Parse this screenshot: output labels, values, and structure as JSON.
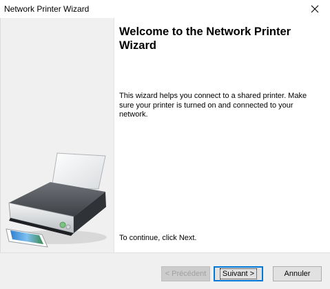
{
  "window": {
    "title": "Network Printer Wizard",
    "close_icon": "close-icon"
  },
  "welcome": {
    "heading": "Welcome to the Network Printer Wizard",
    "description": "This wizard helps you connect to a shared printer.  Make sure your printer is turned on and connected to your network.",
    "continue_text": "To continue, click Next."
  },
  "side_panel": {
    "image": "printer-illustration"
  },
  "buttons": {
    "back_label": "< Précédent",
    "next_label": "Suivant >",
    "cancel_label": "Annuler"
  },
  "colors": {
    "accent": "#0078d7",
    "side_panel_bg": "#f0f0f0",
    "content_bg": "#ffffff"
  }
}
